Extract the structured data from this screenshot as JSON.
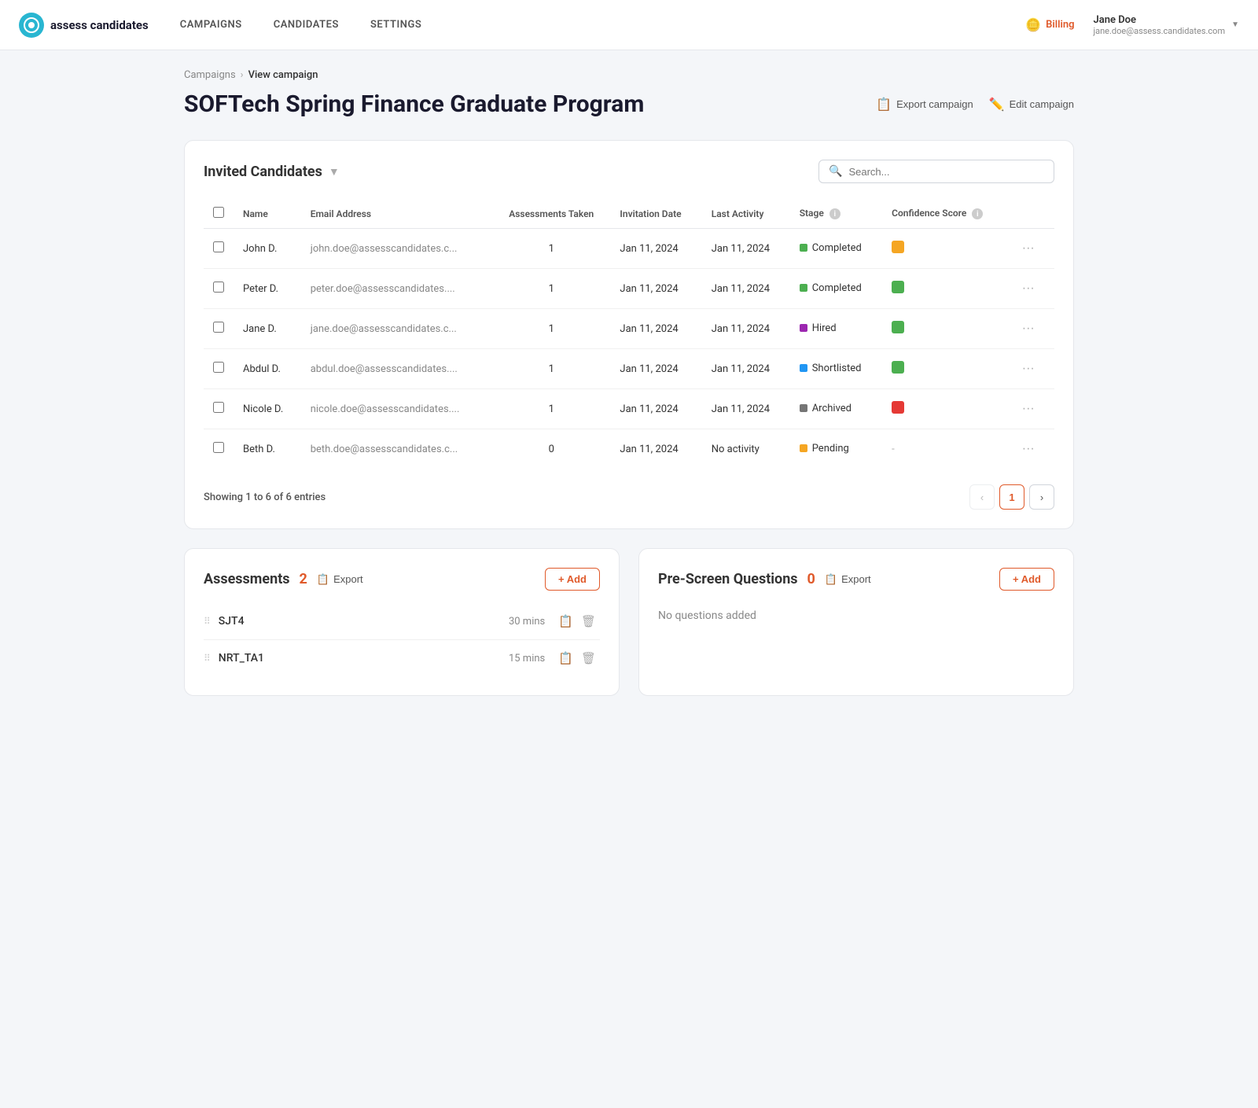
{
  "brand": {
    "name": "assess candidates",
    "icon": "a"
  },
  "nav": {
    "links": [
      "CAMPAIGNS",
      "CANDIDATES",
      "SETTINGS"
    ],
    "billing": "Billing",
    "user": {
      "name": "Jane Doe",
      "email": "jane.doe@assess.candidates.com"
    }
  },
  "breadcrumb": {
    "parent": "Campaigns",
    "current": "View campaign"
  },
  "page": {
    "title": "SOFTech Spring Finance Graduate Program",
    "actions": {
      "export": "Export campaign",
      "edit": "Edit campaign"
    }
  },
  "candidates_section": {
    "title": "Invited Candidates",
    "search_placeholder": "Search...",
    "columns": {
      "name": "Name",
      "email": "Email Address",
      "assessments_taken": "Assessments Taken",
      "invitation_date": "Invitation Date",
      "last_activity": "Last Activity",
      "stage": "Stage",
      "confidence_score": "Confidence Score"
    },
    "rows": [
      {
        "name": "John D.",
        "email": "john.doe@assesscandidates.c...",
        "assessments_taken": "1",
        "invitation_date": "Jan 11, 2024",
        "last_activity": "Jan 11, 2024",
        "stage": "Completed",
        "stage_color": "#4caf50",
        "confidence_color": "#f5a623",
        "dash": false
      },
      {
        "name": "Peter D.",
        "email": "peter.doe@assesscandidates....",
        "assessments_taken": "1",
        "invitation_date": "Jan 11, 2024",
        "last_activity": "Jan 11, 2024",
        "stage": "Completed",
        "stage_color": "#4caf50",
        "confidence_color": "#4caf50",
        "dash": false
      },
      {
        "name": "Jane D.",
        "email": "jane.doe@assesscandidates.c...",
        "assessments_taken": "1",
        "invitation_date": "Jan 11, 2024",
        "last_activity": "Jan 11, 2024",
        "stage": "Hired",
        "stage_color": "#9c27b0",
        "confidence_color": "#4caf50",
        "dash": false
      },
      {
        "name": "Abdul D.",
        "email": "abdul.doe@assesscandidates....",
        "assessments_taken": "1",
        "invitation_date": "Jan 11, 2024",
        "last_activity": "Jan 11, 2024",
        "stage": "Shortlisted",
        "stage_color": "#2196f3",
        "confidence_color": "#4caf50",
        "dash": false
      },
      {
        "name": "Nicole D.",
        "email": "nicole.doe@assesscandidates....",
        "assessments_taken": "1",
        "invitation_date": "Jan 11, 2024",
        "last_activity": "Jan 11, 2024",
        "stage": "Archived",
        "stage_color": "#757575",
        "confidence_color": "#e53935",
        "dash": false
      },
      {
        "name": "Beth D.",
        "email": "beth.doe@assesscandidates.c...",
        "assessments_taken": "0",
        "invitation_date": "Jan 11, 2024",
        "last_activity": "No activity",
        "stage": "Pending",
        "stage_color": "#f5a623",
        "confidence_color": null,
        "dash": true
      }
    ],
    "showing_text": "Showing 1 to 6 of 6 entries",
    "current_page": "1"
  },
  "assessments_section": {
    "title": "Assessments",
    "count": "2",
    "export_label": "Export",
    "add_label": "+ Add",
    "items": [
      {
        "name": "SJT4",
        "duration": "30 mins"
      },
      {
        "name": "NRT_TA1",
        "duration": "15 mins"
      }
    ]
  },
  "prescreen_section": {
    "title": "Pre-Screen Questions",
    "count": "0",
    "export_label": "Export",
    "add_label": "+ Add",
    "empty_text": "No questions added"
  }
}
